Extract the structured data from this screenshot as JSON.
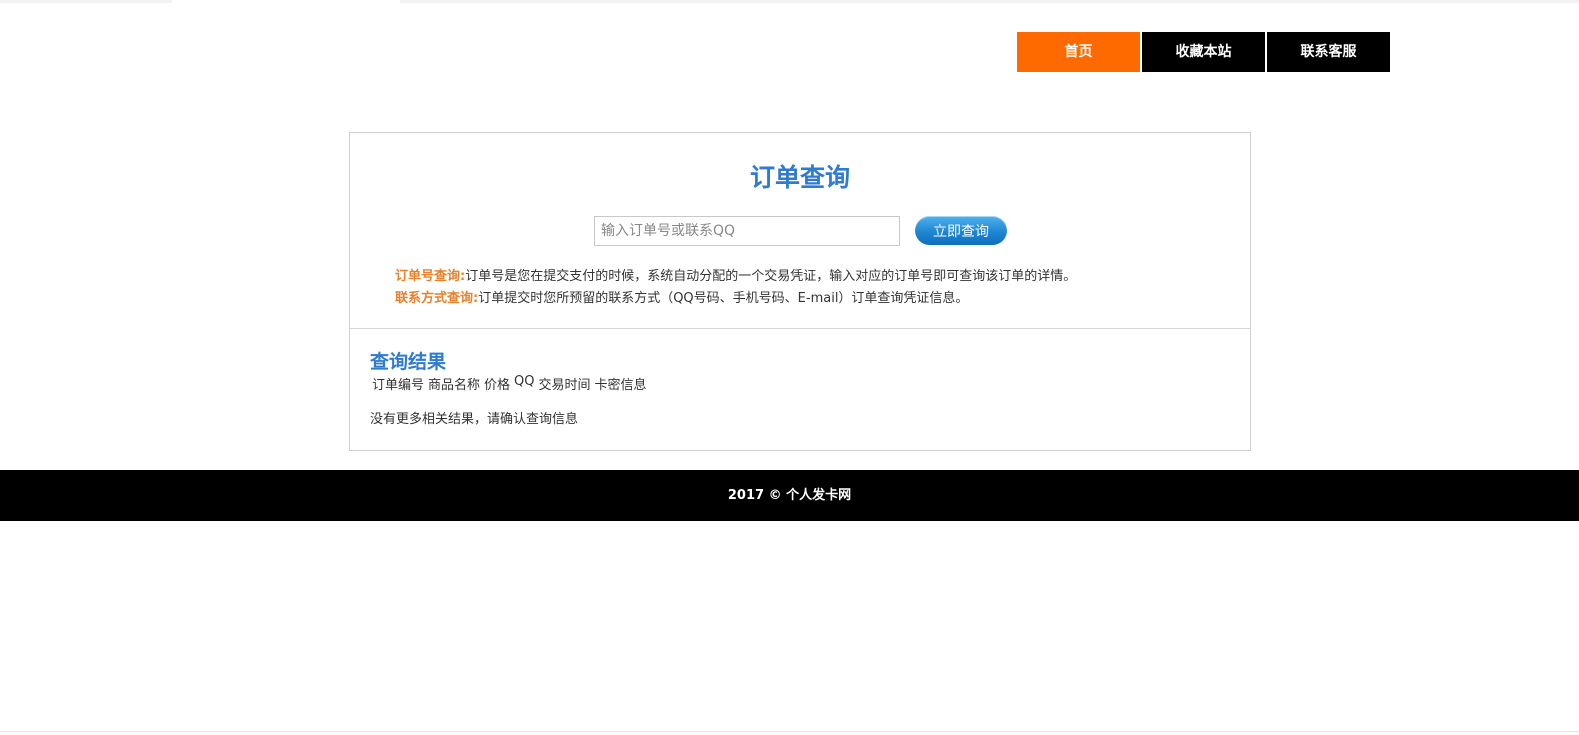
{
  "nav": {
    "items": [
      {
        "label": "首页",
        "active": true
      },
      {
        "label": "收藏本站",
        "active": false
      },
      {
        "label": "联系客服",
        "active": false
      }
    ]
  },
  "query": {
    "title": "订单查询",
    "input_placeholder": "输入订单号或联系QQ",
    "input_value": "",
    "button_label": "立即查询"
  },
  "help": [
    {
      "label": "订单号查询:",
      "text": "订单号是您在提交支付的时候，系统自动分配的一个交易凭证，输入对应的订单号即可查询该订单的详情。"
    },
    {
      "label": "联系方式查询:",
      "text": "订单提交时您所预留的联系方式（QQ号码、手机号码、E-mail）订单查询凭证信息。"
    }
  ],
  "results": {
    "title": "查询结果",
    "columns": [
      "订单编号",
      "商品名称",
      "价格",
      "QQ",
      "交易时间",
      "卡密信息"
    ],
    "empty_message": "没有更多相关结果，请确认查询信息"
  },
  "footer": {
    "text": "2017 © 个人发卡网"
  },
  "colors": {
    "accent_orange": "#ff6a00",
    "title_blue": "#2e7bcf",
    "label_orange": "#e8812a",
    "footer_bg": "#000000"
  }
}
